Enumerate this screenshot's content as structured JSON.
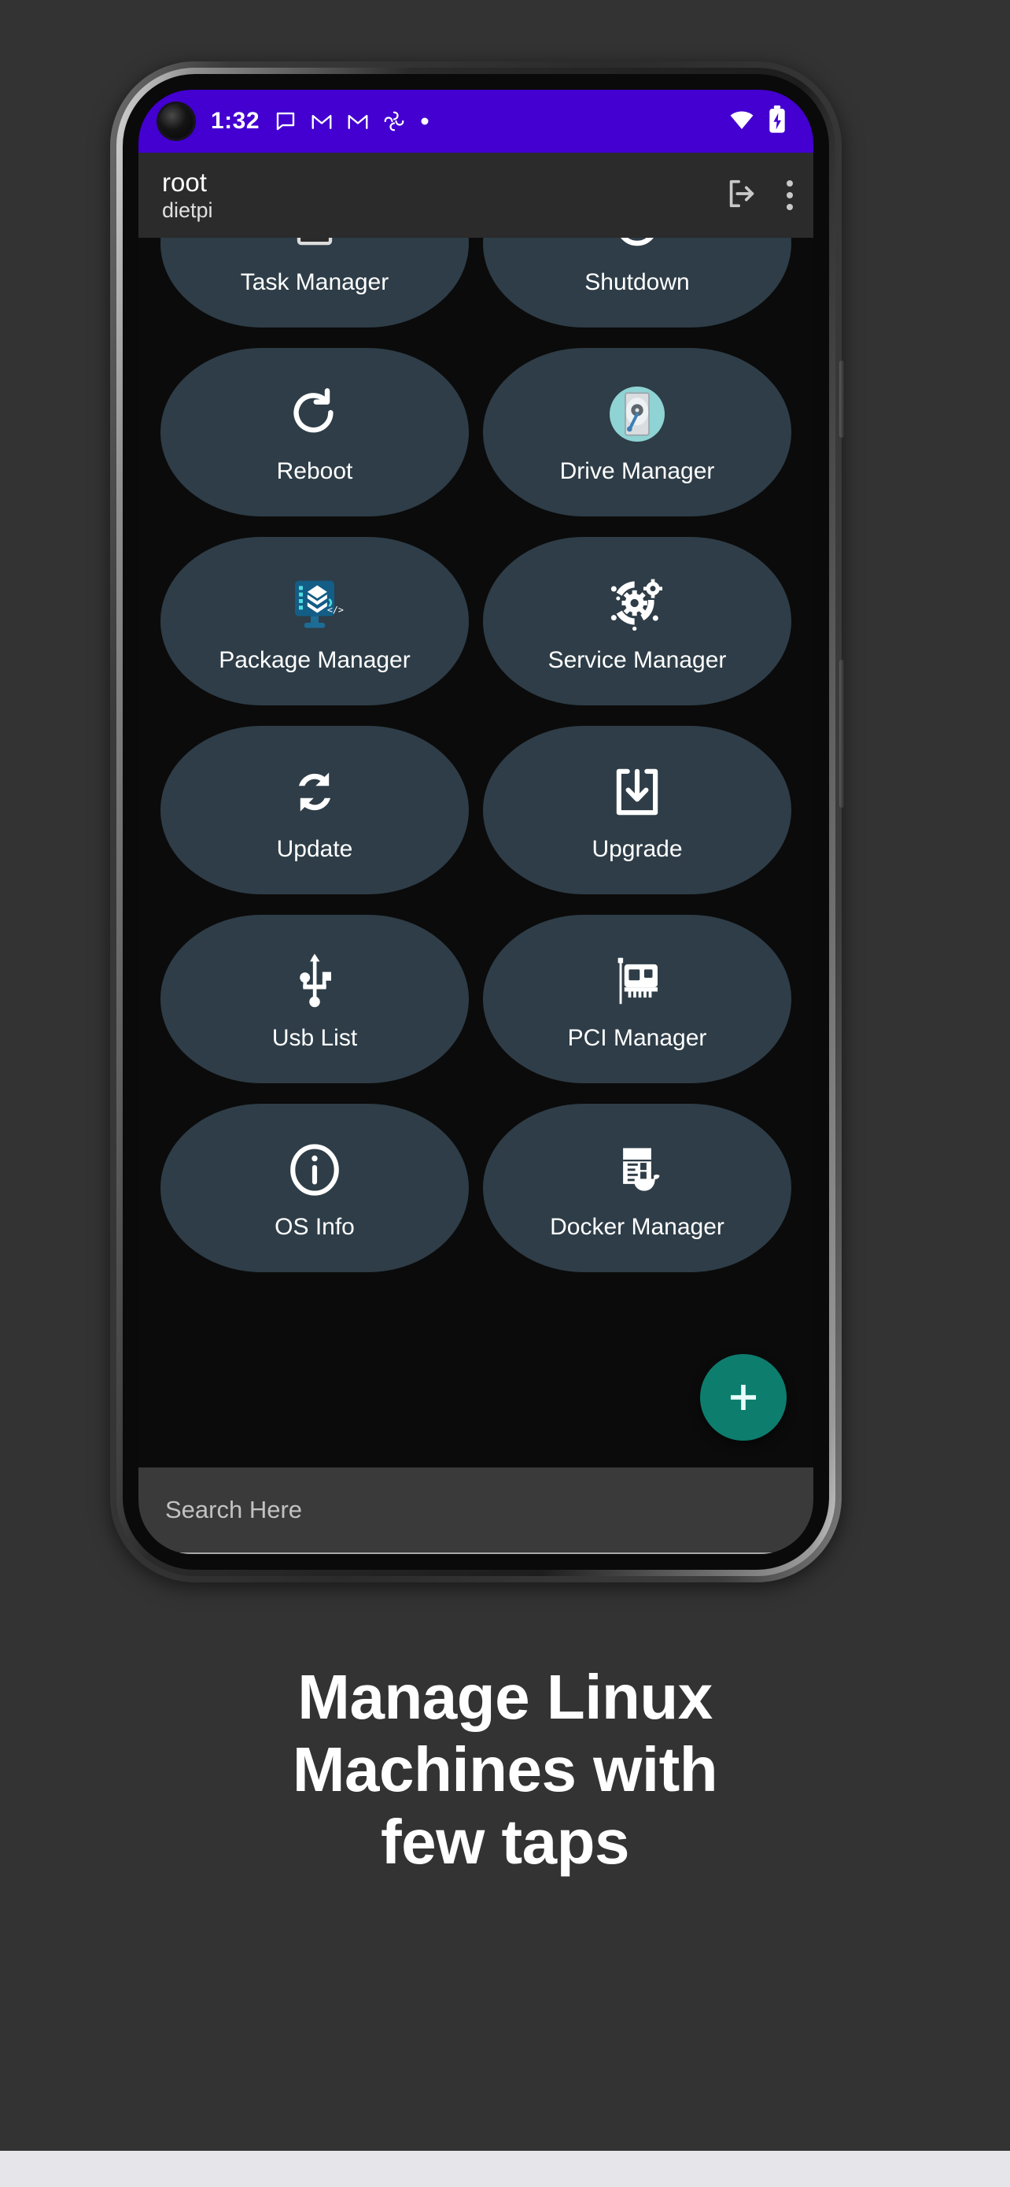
{
  "poster": {
    "background_color": "#333333",
    "footer_color": "#e6e6ea",
    "headline_lines": [
      "Manage Linux",
      "Machines with",
      "few taps"
    ]
  },
  "phone": {
    "statusbar": {
      "background_color": "#4300d0",
      "time": "1:32",
      "left_icons": [
        "chat-bubble-icon",
        "gmail-icon",
        "gmail-icon",
        "google-photos-icon",
        "dot-icon"
      ],
      "right_icons": [
        "wifi-icon",
        "battery-charging-icon"
      ]
    },
    "appbar": {
      "background_color": "#2b2b2b",
      "title": "root",
      "subtitle": "dietpi",
      "logout_label": "logout-icon",
      "overflow_label": "more-options-icon"
    },
    "grid": {
      "background_color": "#0b0b0b",
      "tile_color": "#2e3d47",
      "items": [
        {
          "label": "Task Manager",
          "icon": "task-manager-icon"
        },
        {
          "label": "Shutdown",
          "icon": "power-icon"
        },
        {
          "label": "Reboot",
          "icon": "refresh-icon"
        },
        {
          "label": "Drive Manager",
          "icon": "hard-drive-icon"
        },
        {
          "label": "Package Manager",
          "icon": "package-manager-icon"
        },
        {
          "label": "Service Manager",
          "icon": "service-gears-icon"
        },
        {
          "label": "Update",
          "icon": "sync-icon"
        },
        {
          "label": "Upgrade",
          "icon": "download-box-icon"
        },
        {
          "label": "Usb List",
          "icon": "usb-icon"
        },
        {
          "label": "PCI Manager",
          "icon": "pci-card-icon"
        },
        {
          "label": "OS Info",
          "icon": "info-icon"
        },
        {
          "label": "Docker Manager",
          "icon": "docker-whale-icon"
        }
      ]
    },
    "fab": {
      "label": "+",
      "color": "#0d7d6e",
      "name": "add-connection-button"
    },
    "search": {
      "placeholder": "Search Here",
      "value": "",
      "background_color": "#3a3a3a"
    },
    "navbar": {
      "gesture_pill": "home-gesture-pill"
    }
  }
}
